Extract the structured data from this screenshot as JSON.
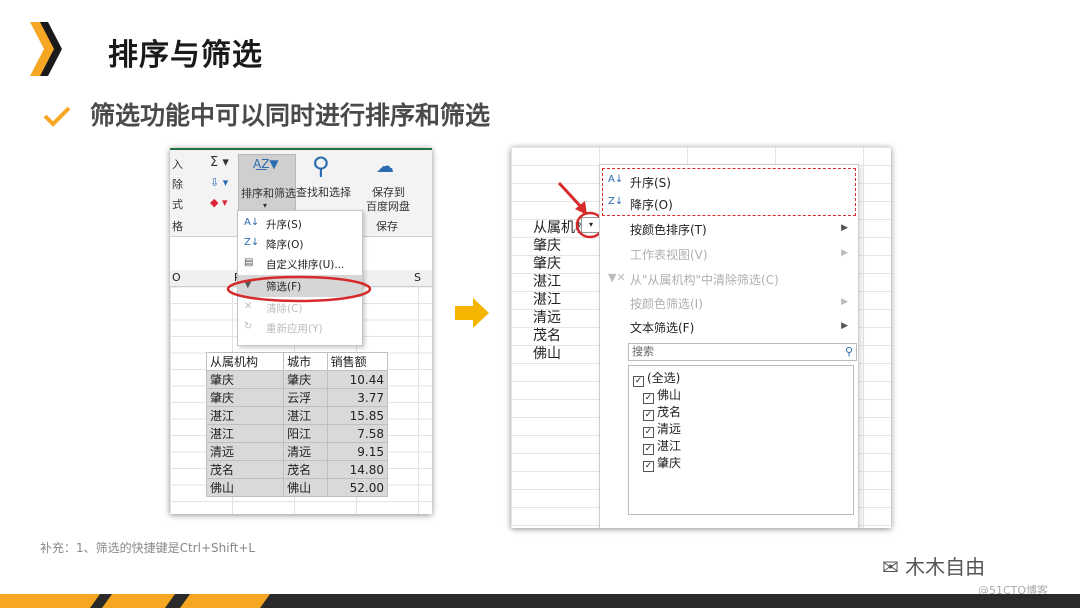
{
  "slide": {
    "title": "排序与筛选",
    "subtitle": "筛选功能中可以同时进行排序和筛选",
    "note": "补充：1、筛选的快捷键是Ctrl+Shift+L",
    "watermark": "木木自由",
    "watermark_small": "@51CTO博客",
    "accent_color": "#f5a623"
  },
  "left": {
    "ribbon": {
      "partial_labels": [
        "入",
        "除",
        "式",
        "格"
      ],
      "sort_filter": "排序和筛选",
      "find_select": "查找和选择",
      "save_to": "保存到",
      "baidu": "百度网盘",
      "save_group": "保存"
    },
    "menu": {
      "asc": "升序(S)",
      "desc": "降序(O)",
      "custom": "自定义排序(U)...",
      "filter": "筛选(F)",
      "clear": "清除(C)",
      "reapply": "重新应用(Y)"
    },
    "col_headers": [
      "O",
      "P",
      "S"
    ],
    "table": {
      "headers": [
        "从属机构",
        "城市",
        "销售额"
      ],
      "rows": [
        [
          "肇庆",
          "肇庆",
          "10.44"
        ],
        [
          "肇庆",
          "云浮",
          "3.77"
        ],
        [
          "湛江",
          "湛江",
          "15.85"
        ],
        [
          "湛江",
          "阳江",
          "7.58"
        ],
        [
          "清远",
          "清远",
          "9.15"
        ],
        [
          "茂名",
          "茂名",
          "14.80"
        ],
        [
          "佛山",
          "佛山",
          "52.00"
        ]
      ]
    }
  },
  "right": {
    "column_cells": [
      "从属机构",
      "肇庆",
      "肇庆",
      "湛江",
      "湛江",
      "清远",
      "茂名",
      "佛山"
    ],
    "menu": {
      "asc": "升序(S)",
      "desc": "降序(O)",
      "by_color": "按颜色排序(T)",
      "sheet_view": "工作表视图(V)",
      "clear_filter": "从\"从属机构\"中清除筛选(C)",
      "color_filter": "按颜色筛选(I)",
      "text_filter": "文本筛选(F)",
      "search_placeholder": "搜索",
      "items": [
        "(全选)",
        "佛山",
        "茂名",
        "清远",
        "湛江",
        "肇庆"
      ]
    }
  }
}
